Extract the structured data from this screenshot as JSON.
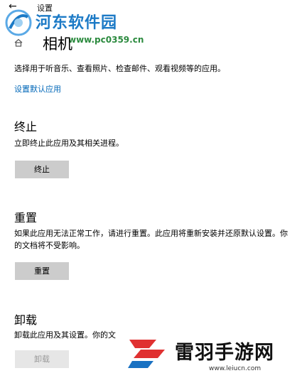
{
  "window": {
    "title": "设置",
    "back_label": "←"
  },
  "watermark_top": {
    "name": "河东软件园",
    "url": "www.pc0359.cn"
  },
  "app": {
    "title": "相机",
    "description": "选择用于听音乐、查看照片、检查邮件、观看视频等的应用。",
    "default_apps_link": "设置默认应用"
  },
  "sections": {
    "terminate": {
      "title": "终止",
      "description": "立即终止此应用及其相关进程。",
      "button_label": "终止"
    },
    "reset": {
      "title": "重置",
      "description": "如果此应用无法正常工作，请进行重置。此应用将重新安装并还原默认设置。你的文档将不受影响。",
      "button_label": "重置"
    },
    "uninstall": {
      "title": "卸载",
      "description": "卸载此应用及其设置。你的文",
      "button_label": "卸载"
    }
  },
  "watermark_bottom": {
    "name": "雷羽手游网",
    "url": "www.leiucn.com"
  },
  "colors": {
    "accent_link": "#0067b8",
    "button_bg": "#cccccc",
    "button_disabled_bg": "#e6e6e6"
  }
}
